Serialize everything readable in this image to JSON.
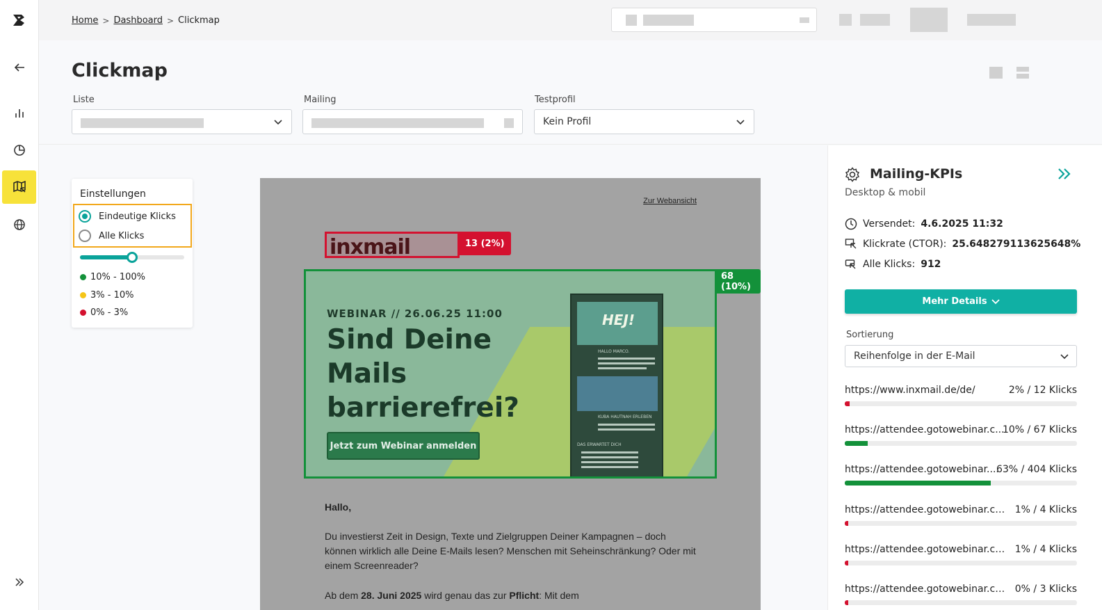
{
  "breadcrumb": {
    "home": "Home",
    "dashboard": "Dashboard",
    "current": "Clickmap",
    "separator": ">"
  },
  "page": {
    "title": "Clickmap"
  },
  "filters": {
    "list_label": "Liste",
    "mailing_label": "Mailing",
    "testprofile_label": "Testprofil",
    "testprofile_value": "Kein Profil"
  },
  "settings": {
    "title": "Einstellungen",
    "option_unique": "Eindeutige Klicks",
    "option_all": "Alle Klicks",
    "selected": "Eindeutige Klicks",
    "threshold_level": 0.5,
    "legend": [
      {
        "label": "10% - 100%",
        "color": "#13913a"
      },
      {
        "label": "3% - 10%",
        "color": "#f5c518"
      },
      {
        "label": "0% - 3%",
        "color": "#d4112f"
      }
    ]
  },
  "email": {
    "webview_link": "Zur Webansicht",
    "logo_text": "inxmail",
    "logo_tag": "13 (2%)",
    "banner_tag": "68 (10%)",
    "banner_subtitle": "WEBINAR // 26.06.25 11:00",
    "banner_headline": "Sind Deine Mails barrierefrei?",
    "banner_cta": "Jetzt zum Webinar anmelden",
    "phone_hero_text": "HEJ!",
    "phone_greeting": "HALLO MARCO.",
    "phone_caption": "KUBA HAUTNAH ERLEBEN",
    "phone_section": "DAS ERWARTET DICH",
    "greeting": "Hallo,",
    "paragraph1": "Du investierst Zeit in Design, Texte und Zielgruppen Deiner Kampagnen – doch können wirklich alle Deine E-Mails lesen? Menschen mit Seheinschränkung? Oder mit einem Screenreader?",
    "paragraph2_start": "Ab dem ",
    "paragraph2_date": "28. Juni 2025",
    "paragraph2_mid": " wird genau das zur ",
    "paragraph2_bold": "Pflicht",
    "paragraph2_end": ": Mit dem"
  },
  "kpis": {
    "title": "Mailing-KPIs",
    "subtitle": "Desktop & mobil",
    "sent_label": "Versendet:",
    "sent_value": "4.6.2025 11:32",
    "ctor_label": "Klickrate (CTOR):",
    "ctor_value": "25.648279113625648%",
    "clicks_label": "Alle Klicks:",
    "clicks_value": "912",
    "more_button": "Mehr Details"
  },
  "sorting": {
    "label": "Sortierung",
    "value": "Reihenfolge in der E-Mail"
  },
  "links": [
    {
      "url": "https://www.inxmail.de/de/",
      "count": "2% / 12 Klicks",
      "share": 0.02,
      "color": "#d4112f"
    },
    {
      "url": "https://attendee.gotowebinar.c...",
      "count": "10% / 67 Klicks",
      "share": 0.1,
      "color": "#13913a"
    },
    {
      "url": "https://attendee.gotowebinar....",
      "count": "63% / 404 Klicks",
      "share": 0.63,
      "color": "#13913a"
    },
    {
      "url": "https://attendee.gotowebinar.com...",
      "count": "1% / 4 Klicks",
      "share": 0.01,
      "color": "#d4112f"
    },
    {
      "url": "https://attendee.gotowebinar.com...",
      "count": "1% / 4 Klicks",
      "share": 0.01,
      "color": "#d4112f"
    },
    {
      "url": "https://attendee.gotowebinar.com...",
      "count": "0% / 3 Klicks",
      "share": 0.0,
      "color": "#d4112f"
    }
  ]
}
